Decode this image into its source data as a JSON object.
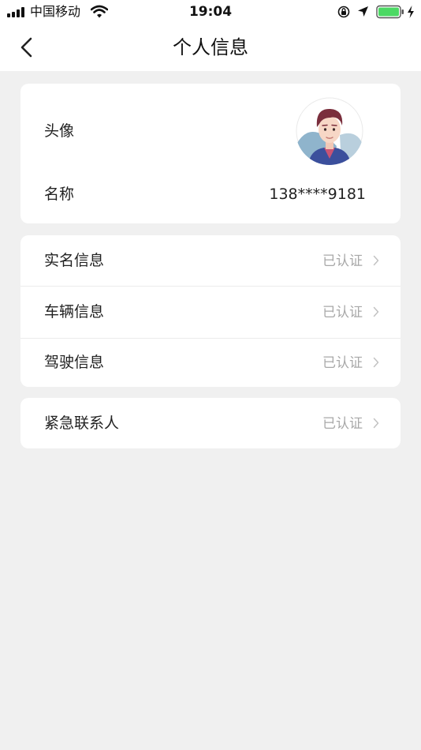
{
  "status_bar": {
    "carrier": "中国移动",
    "time": "19:04"
  },
  "nav": {
    "title": "个人信息"
  },
  "profile": {
    "avatar_label": "头像",
    "name_label": "名称",
    "name_value": "138****9181"
  },
  "info_items": [
    {
      "label": "实名信息",
      "status": "已认证"
    },
    {
      "label": "车辆信息",
      "status": "已认证"
    },
    {
      "label": "驾驶信息",
      "status": "已认证"
    }
  ],
  "emergency": {
    "label": "紧急联系人",
    "status": "已认证"
  },
  "colors": {
    "background": "#f0f0f0",
    "card": "#ffffff",
    "status_text": "#a8a8a8",
    "battery": "#4cd964"
  },
  "icons": {
    "back": "back-chevron-icon",
    "row_arrow": "chevron-right-icon",
    "signal": "signal-icon",
    "wifi": "wifi-icon",
    "rotation_lock": "rotation-lock-icon",
    "location": "location-arrow-icon",
    "battery": "battery-icon",
    "charging": "charging-bolt-icon"
  }
}
